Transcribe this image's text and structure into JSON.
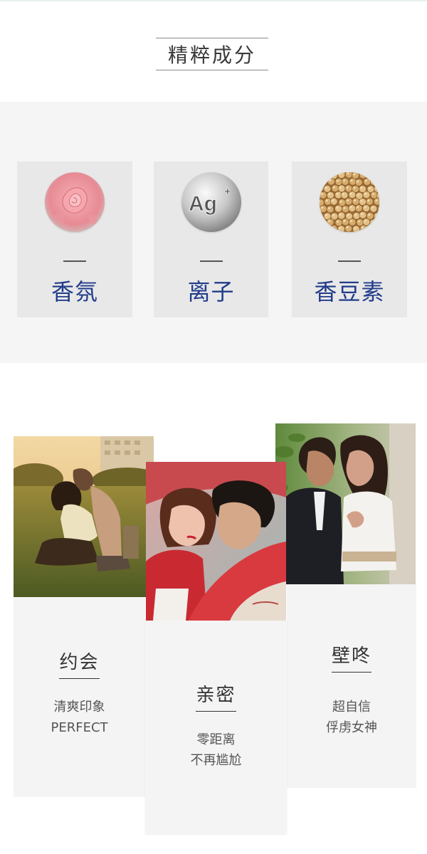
{
  "section": {
    "title": "精粹成分"
  },
  "ingredients": [
    {
      "name": "香氛",
      "icon": "rose-icon"
    },
    {
      "name": "离子",
      "icon": "silver-ion-icon",
      "icon_text": "Ag+"
    },
    {
      "name": "香豆素",
      "icon": "soybeans-icon"
    }
  ],
  "scenes": [
    {
      "title": "约会",
      "line1": "清爽印象",
      "line2": "PERFECT"
    },
    {
      "title": "亲密",
      "line1": "零距离",
      "line2": "不再尴尬"
    },
    {
      "title": "壁咚",
      "line1": "超自信",
      "line2": "俘虏女神"
    }
  ],
  "colors": {
    "accent": "#213c8a",
    "band": "#f5f5f5",
    "card": "#e8e8e8"
  }
}
